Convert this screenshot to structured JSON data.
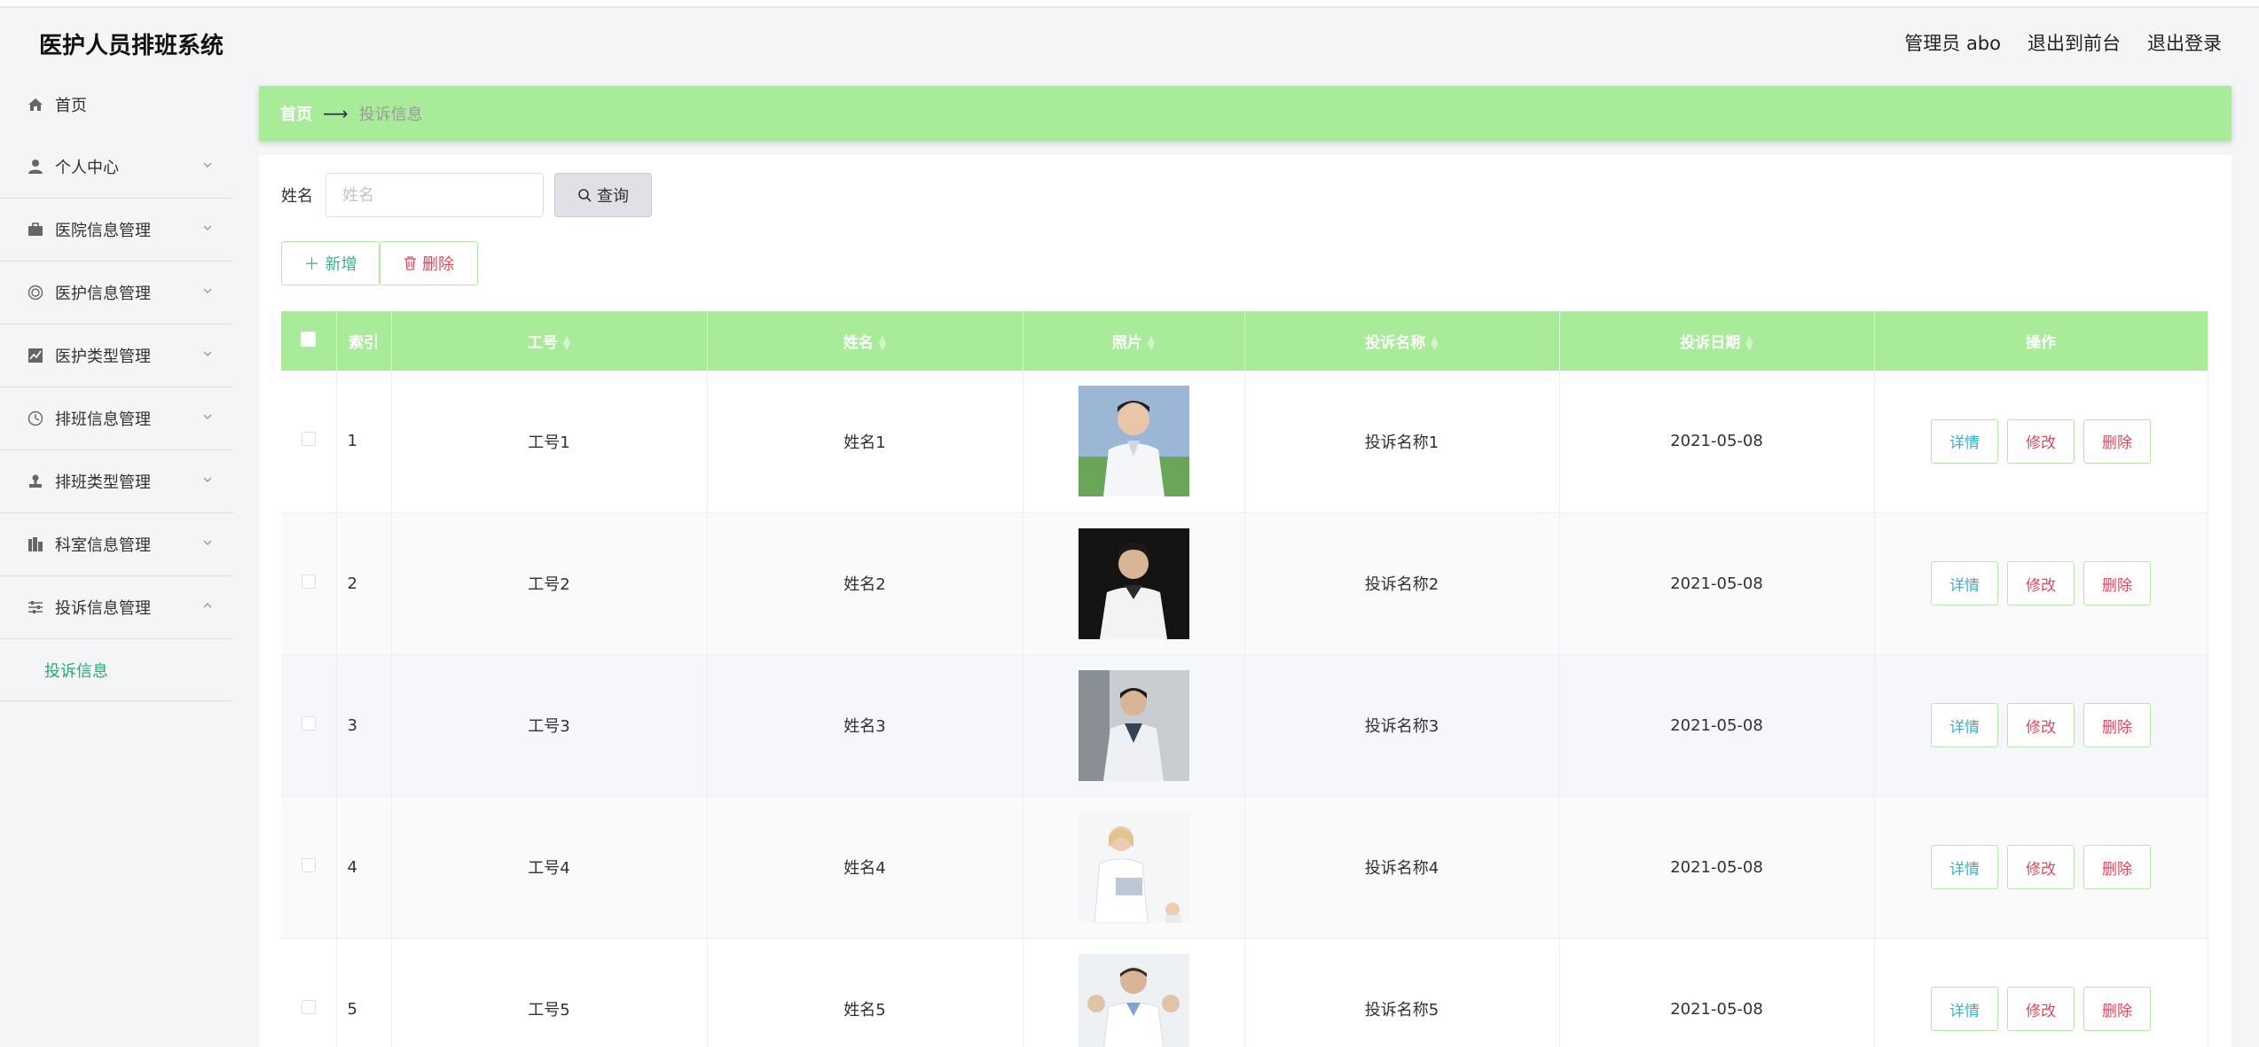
{
  "header": {
    "title": "医护人员排班系统",
    "admin": "管理员 abo",
    "to_front": "退出到前台",
    "logout": "退出登录"
  },
  "sidebar": {
    "items": [
      {
        "label": "首页",
        "icon": "home-icon"
      },
      {
        "label": "个人中心",
        "icon": "user-icon"
      },
      {
        "label": "医院信息管理",
        "icon": "briefcase-icon"
      },
      {
        "label": "医护信息管理",
        "icon": "circle-icon"
      },
      {
        "label": "医护类型管理",
        "icon": "chart-icon"
      },
      {
        "label": "排班信息管理",
        "icon": "clock-icon"
      },
      {
        "label": "排班类型管理",
        "icon": "stamp-icon"
      },
      {
        "label": "科室信息管理",
        "icon": "building-icon"
      },
      {
        "label": "投诉信息管理",
        "icon": "sliders-icon"
      }
    ],
    "sub_item": "投诉信息"
  },
  "breadcrumb": {
    "home": "首页",
    "current": "投诉信息"
  },
  "search": {
    "label": "姓名",
    "placeholder": "姓名",
    "button": "查询"
  },
  "actions": {
    "add": "新增",
    "delete": "删除"
  },
  "table": {
    "columns": [
      "索引",
      "工号",
      "姓名",
      "照片",
      "投诉名称",
      "投诉日期",
      "操作"
    ],
    "rows": [
      {
        "index": "1",
        "job_no": "工号1",
        "name": "姓名1",
        "complaint": "投诉名称1",
        "date": "2021-05-08"
      },
      {
        "index": "2",
        "job_no": "工号2",
        "name": "姓名2",
        "complaint": "投诉名称2",
        "date": "2021-05-08"
      },
      {
        "index": "3",
        "job_no": "工号3",
        "name": "姓名3",
        "complaint": "投诉名称3",
        "date": "2021-05-08"
      },
      {
        "index": "4",
        "job_no": "工号4",
        "name": "姓名4",
        "complaint": "投诉名称4",
        "date": "2021-05-08"
      },
      {
        "index": "5",
        "job_no": "工号5",
        "name": "姓名5",
        "complaint": "投诉名称5",
        "date": "2021-05-08"
      }
    ],
    "row_actions": {
      "detail": "详情",
      "edit": "修改",
      "delete": "删除"
    }
  },
  "colors": {
    "accent_green": "#a8ec9a",
    "active_text": "#2aa876",
    "danger": "#e3485b",
    "info": "#35b4c9"
  }
}
